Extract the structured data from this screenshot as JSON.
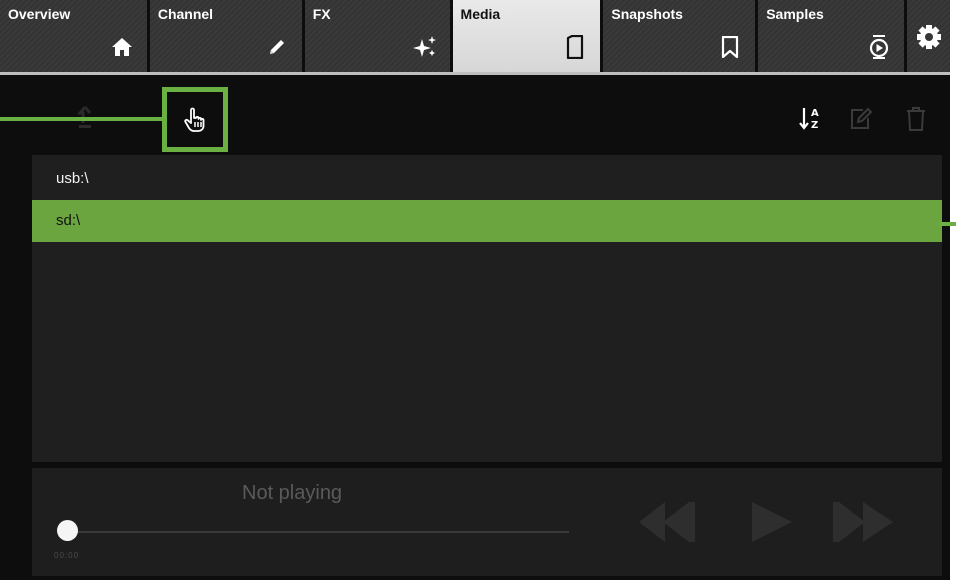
{
  "tabs": [
    {
      "label": "Overview",
      "icon": "home-icon"
    },
    {
      "label": "Channel",
      "icon": "pencil-icon"
    },
    {
      "label": "FX",
      "icon": "sparkle-icon"
    },
    {
      "label": "Media",
      "icon": "sd-card-icon",
      "active": true
    },
    {
      "label": "Snapshots",
      "icon": "bookmark-icon"
    },
    {
      "label": "Samples",
      "icon": "sample-player-icon"
    },
    {
      "label": "",
      "icon": "gear-icon"
    }
  ],
  "toolbar": {
    "icons": [
      "up-folder-icon",
      "touch-select-icon",
      "sort-az-icon",
      "edit-icon",
      "trash-icon"
    ],
    "highlight_color": "#6ab042"
  },
  "files": [
    {
      "name": "usb:\\",
      "selected": false
    },
    {
      "name": "sd:\\",
      "selected": true
    }
  ],
  "player": {
    "status": "Not playing",
    "time_start": "00:00",
    "time_end": "",
    "controls": [
      "rewind-icon",
      "play-icon",
      "fast-forward-icon"
    ]
  },
  "colors": {
    "background": "#0d0d0d",
    "selected_row": "#6ba53f",
    "active_tab": "#e0e0e0"
  }
}
